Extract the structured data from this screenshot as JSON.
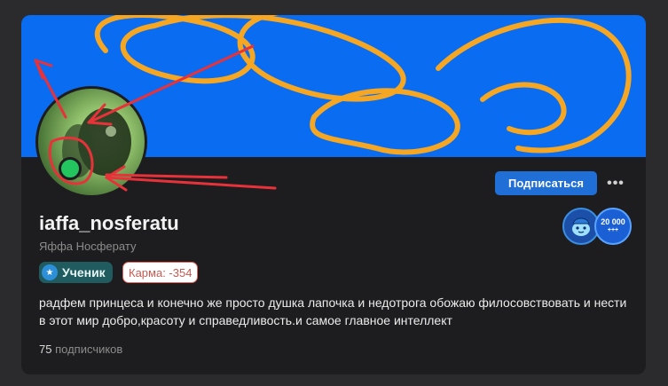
{
  "profile": {
    "username": "iaffa_nosferatu",
    "full_name": "Яффа Носферату",
    "rank_label": "Ученик",
    "karma_label": "Карма: -354",
    "bio": "радфем принцеса и конечно же просто душка лапочка и недотрога обожаю филосовствовать и нести в этот мир добро,красоту и справедливость.и самое главное интеллект",
    "followers_count": "75",
    "followers_label": "подписчиков"
  },
  "actions": {
    "subscribe_label": "Подписаться",
    "more_label": "•••"
  },
  "awards": {
    "second_value": "20 000",
    "second_suffix": "+++"
  },
  "icons": {
    "more": "more-dots-icon",
    "rank": "student-icon",
    "award_1": "mascot-award-icon",
    "award_2": "followers-20000-award-icon"
  },
  "colors": {
    "cover": "#0a6cf0",
    "cover_lines": "#f5a623",
    "annotation": "#e8323a",
    "accent": "#1f6fd6",
    "card": "#1d1d1f",
    "karma": "#c45a52",
    "rank_bg": "#1f5b5f",
    "online": "#22c55e"
  }
}
